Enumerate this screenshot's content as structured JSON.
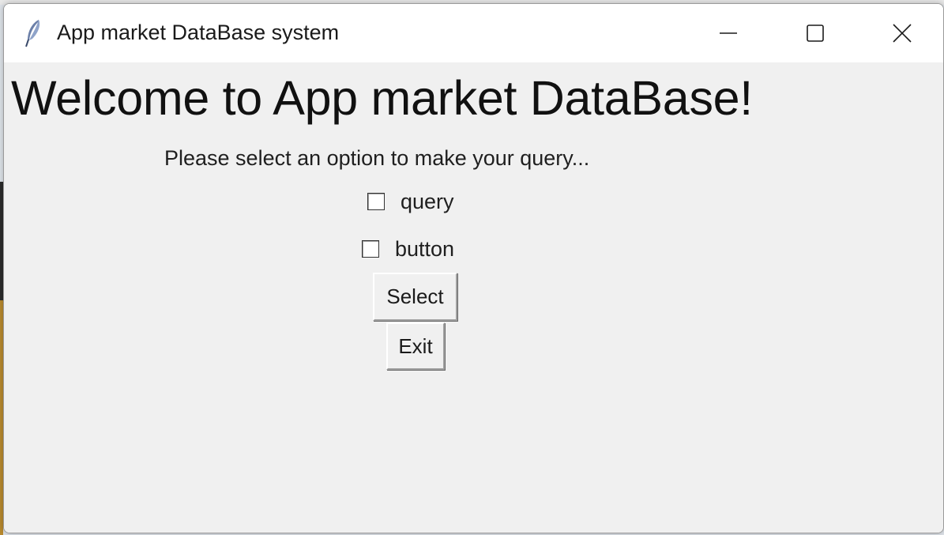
{
  "window": {
    "title": "App market DataBase system",
    "controls": {
      "minimize_icon": "minimize-icon",
      "maximize_icon": "maximize-icon",
      "close_icon": "close-icon"
    },
    "app_icon": "feather-icon"
  },
  "main": {
    "heading": "Welcome to App market DataBase!",
    "prompt": "Please select an option to make your query...",
    "options": [
      {
        "label": "query",
        "checked": false
      },
      {
        "label": "button",
        "checked": false
      }
    ],
    "buttons": {
      "select_label": "Select",
      "exit_label": "Exit"
    }
  },
  "colors": {
    "window_bg": "#f0f0f0",
    "titlebar_bg": "#ffffff",
    "text": "#111111"
  }
}
